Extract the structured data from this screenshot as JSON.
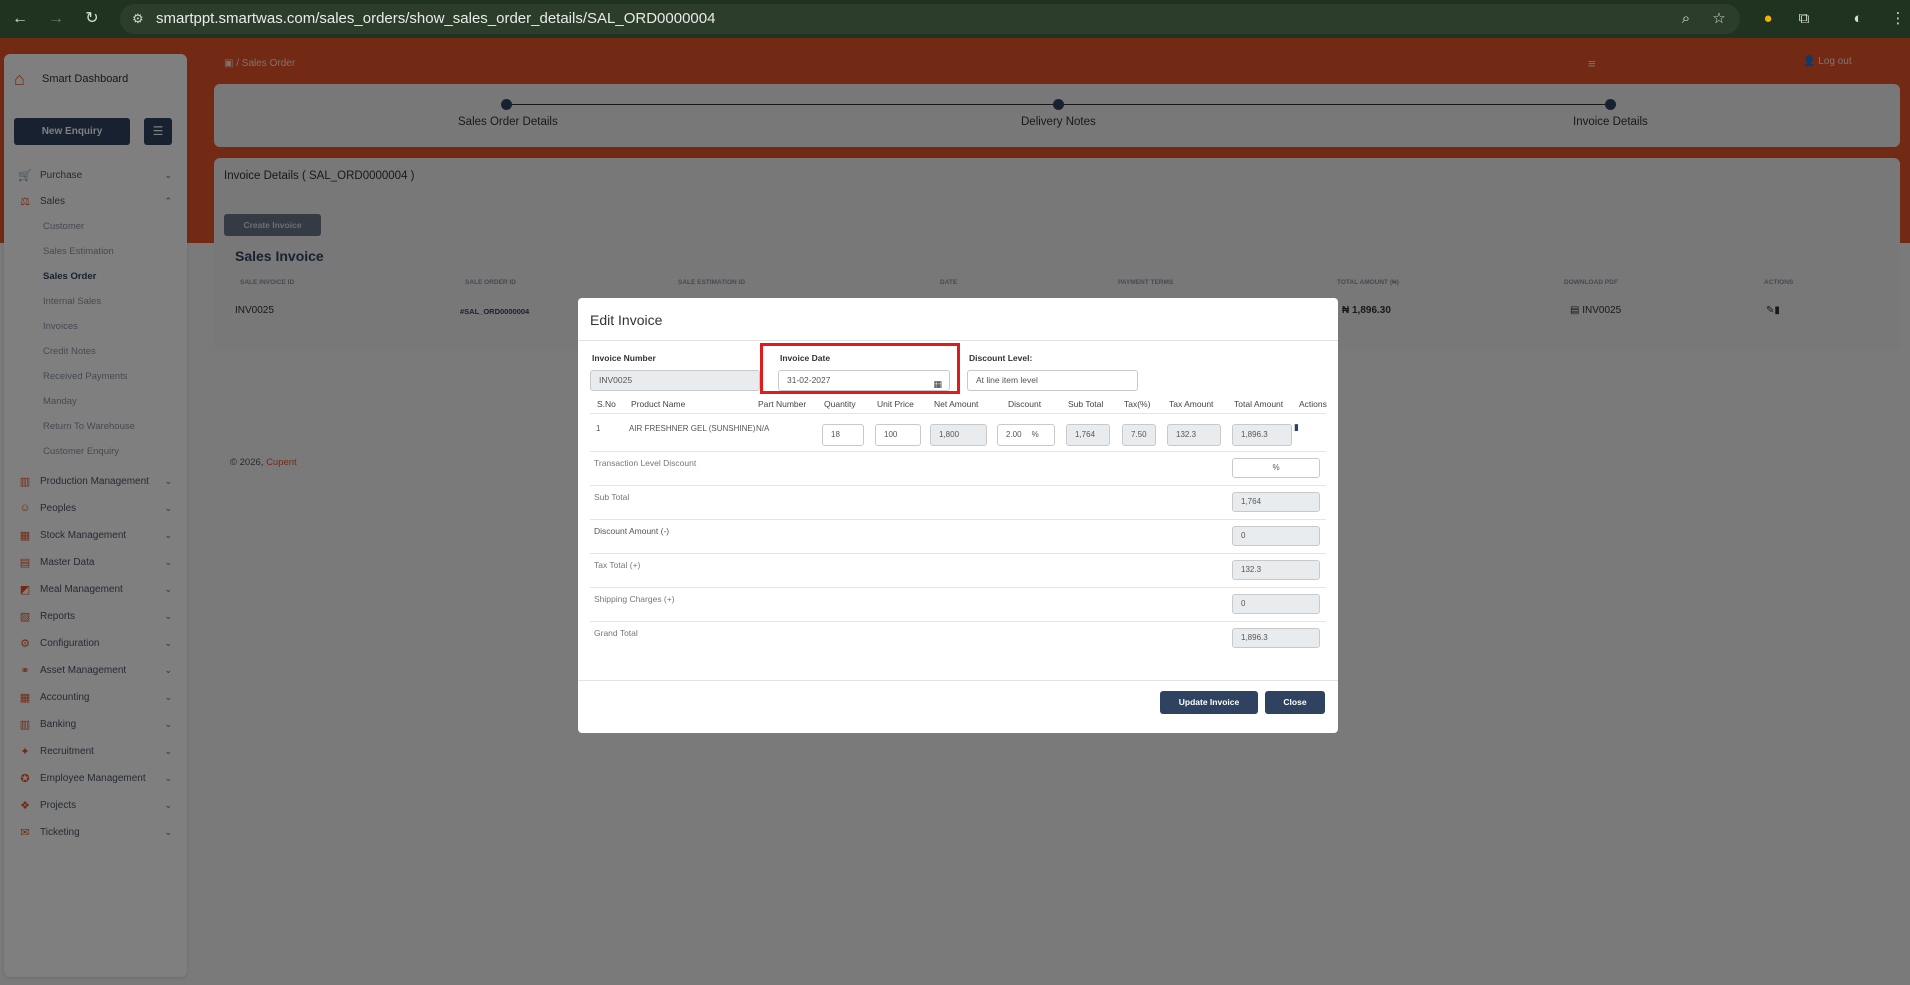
{
  "browser": {
    "url": "smartppt.smartwas.com/sales_orders/show_sales_order_details/SAL_ORD0000004"
  },
  "sidebar": {
    "brand": "Smart Dashboard",
    "new_enquiry": "New Enquiry",
    "items": [
      {
        "label": "Purchase",
        "icon": "cart-icon"
      },
      {
        "label": "Sales",
        "icon": "sales-icon"
      },
      {
        "label": "Production Management",
        "icon": "factory-icon"
      },
      {
        "label": "Peoples",
        "icon": "people-icon"
      },
      {
        "label": "Stock Management",
        "icon": "stock-icon"
      },
      {
        "label": "Master Data",
        "icon": "grid-icon"
      },
      {
        "label": "Meal Management",
        "icon": "meal-icon"
      },
      {
        "label": "Reports",
        "icon": "report-icon"
      },
      {
        "label": "Configuration",
        "icon": "config-icon"
      },
      {
        "label": "Asset Management",
        "icon": "asset-icon"
      },
      {
        "label": "Accounting",
        "icon": "accounting-icon"
      },
      {
        "label": "Banking",
        "icon": "bank-icon"
      },
      {
        "label": "Recruitment",
        "icon": "recruit-icon"
      },
      {
        "label": "Employee Management",
        "icon": "employee-icon"
      },
      {
        "label": "Projects",
        "icon": "project-icon"
      },
      {
        "label": "Ticketing",
        "icon": "ticket-icon"
      }
    ],
    "sales_sub": [
      "Customer",
      "Sales Estimation",
      "Sales Order",
      "Internal Sales",
      "Invoices",
      "Credit Notes",
      "Received Payments",
      "Manday",
      "Return To Warehouse",
      "Customer Enquiry"
    ],
    "active_sub": "Sales Order"
  },
  "header": {
    "breadcrumb_sep": "/",
    "breadcrumb_page": "Sales Order",
    "logout": "Log out"
  },
  "stepper": {
    "steps": [
      "Sales Order Details",
      "Delivery Notes",
      "Invoice Details"
    ]
  },
  "invoice_section": {
    "title": "Invoice Details ( SAL_ORD0000004 )",
    "create_button": "Create Invoice",
    "table_title": "Sales Invoice",
    "columns": [
      "SALE INVOICE ID",
      "SALE ORDER ID",
      "SALE ESTIMATION ID",
      "DATE",
      "PAYMENT TERMS",
      "TOTAL AMOUNT (₦)",
      "DOWNLOAD PDF",
      "ACTIONS"
    ],
    "row": {
      "invoice_id": "INV0025",
      "order_id": "#SAL_ORD0000004",
      "total": "₦ 1,896.30",
      "pdf": "INV0025"
    }
  },
  "footer": {
    "text": "© 2026,",
    "company": "Cupent"
  },
  "modal": {
    "title": "Edit Invoice",
    "invoice_number_label": "Invoice Number",
    "invoice_number": "INV0025",
    "invoice_date_label": "Invoice Date",
    "invoice_date": "31-02-2027",
    "discount_level_label": "Discount Level:",
    "discount_level": "At line item level",
    "columns": [
      "S.No",
      "Product Name",
      "Part Number",
      "Quantity",
      "Unit Price",
      "Net Amount",
      "Discount",
      "Sub Total",
      "Tax(%)",
      "Tax Amount",
      "Total Amount",
      "Actions"
    ],
    "line": {
      "sno": "1",
      "product": "AIR FRESHNER GEL (SUNSHINE)",
      "part": "N/A",
      "quantity": "18",
      "unit_price": "100",
      "net_amount": "1,800",
      "discount": "2.00",
      "discount_unit": "%",
      "sub_total": "1,764",
      "tax_pct": "7.50",
      "tax_amount": "132.3",
      "total_amount": "1,896.3"
    },
    "summary": {
      "transaction_discount_label": "Transaction Level Discount",
      "transaction_discount_unit": "%",
      "sub_total_label": "Sub Total",
      "sub_total": "1,764",
      "discount_amount_label": "Discount Amount (-)",
      "discount_amount": "0",
      "tax_total_label": "Tax Total (+)",
      "tax_total": "132.3",
      "shipping_label": "Shipping Charges (+)",
      "shipping": "0",
      "grand_total_label": "Grand Total",
      "grand_total": "1,896.3"
    },
    "update_button": "Update Invoice",
    "close_button": "Close"
  }
}
